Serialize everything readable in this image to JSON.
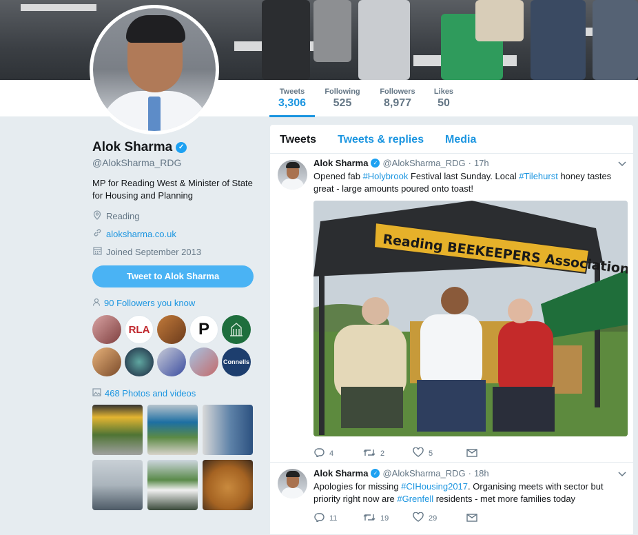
{
  "stats": [
    {
      "label": "Tweets",
      "value": "3,306"
    },
    {
      "label": "Following",
      "value": "525"
    },
    {
      "label": "Followers",
      "value": "8,977"
    },
    {
      "label": "Likes",
      "value": "50"
    }
  ],
  "profile": {
    "name": "Alok Sharma",
    "handle": "@AlokSharma_RDG",
    "bio": "MP for Reading West & Minister of State for Housing and Planning",
    "location": "Reading",
    "website": "aloksharma.co.uk",
    "joined": "Joined September 2013",
    "tweet_to_label": "Tweet to Alok Sharma",
    "followers_you_know": "90 Followers you know",
    "photos_videos": "468 Photos and videos"
  },
  "follower_avatars": [
    {
      "label": ""
    },
    {
      "label": "RLA"
    },
    {
      "label": ""
    },
    {
      "label": "P"
    },
    {
      "label": ""
    },
    {
      "label": ""
    },
    {
      "label": ""
    },
    {
      "label": ""
    },
    {
      "label": ""
    },
    {
      "label": "Connells"
    }
  ],
  "tabs": [
    "Tweets",
    "Tweets & replies",
    "Media"
  ],
  "tweets": [
    {
      "name": "Alok Sharma",
      "handle": "@AlokSharma_RDG",
      "time": "17h",
      "text_parts": [
        {
          "t": "Opened fab ",
          "tag": false
        },
        {
          "t": "#Holybrook",
          "tag": true
        },
        {
          "t": " Festival last Sunday. Local ",
          "tag": false
        },
        {
          "t": "#Tilehurst",
          "tag": true
        },
        {
          "t": " honey tastes great - large amounts poured onto toast!",
          "tag": false
        }
      ],
      "photo_banner": "Reading BEEKEEPERS Association",
      "replies": "4",
      "retweets": "2",
      "likes": "5"
    },
    {
      "name": "Alok Sharma",
      "handle": "@AlokSharma_RDG",
      "time": "18h",
      "text_parts": [
        {
          "t": "Apologies for missing ",
          "tag": false
        },
        {
          "t": "#CIHousing2017",
          "tag": true
        },
        {
          "t": ". Organising meets with sector but priority right now are ",
          "tag": false
        },
        {
          "t": "#Grenfell",
          "tag": true
        },
        {
          "t": " residents - met more families today",
          "tag": false
        }
      ],
      "replies": "11",
      "retweets": "19",
      "likes": "29"
    }
  ],
  "colors": {
    "accent": "#1b95e0",
    "button": "#4ab3f4",
    "muted": "#657786",
    "background": "#e6ecf0"
  },
  "icons": [
    "location-icon",
    "link-icon",
    "calendar-icon",
    "people-icon",
    "image-icon",
    "reply-icon",
    "retweet-icon",
    "heart-icon",
    "message-icon",
    "chevron-down-icon",
    "verified-icon"
  ]
}
